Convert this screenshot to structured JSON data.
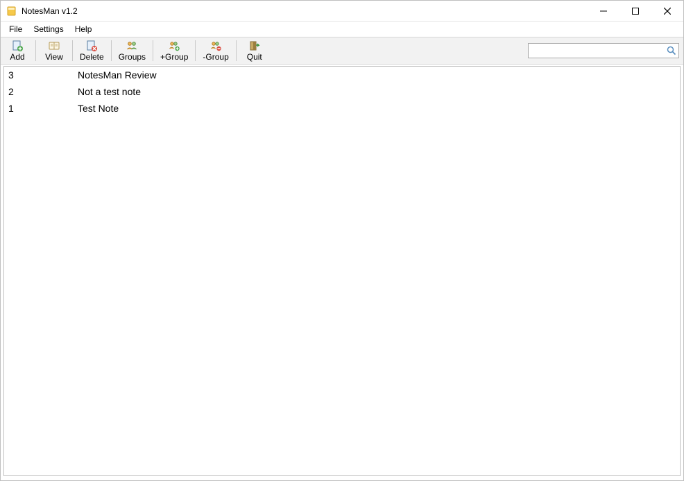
{
  "window": {
    "title": "NotesMan v1.2"
  },
  "menubar": {
    "file": "File",
    "settings": "Settings",
    "help": "Help"
  },
  "toolbar": {
    "add": "Add",
    "view": "View",
    "delete": "Delete",
    "groups": "Groups",
    "add_group": "+Group",
    "remove_group": "-Group",
    "quit": "Quit"
  },
  "search": {
    "value": "",
    "placeholder": ""
  },
  "notes": [
    {
      "id": "3",
      "title": "NotesMan Review"
    },
    {
      "id": "2",
      "title": "Not a test note"
    },
    {
      "id": "1",
      "title": "Test Note"
    }
  ]
}
